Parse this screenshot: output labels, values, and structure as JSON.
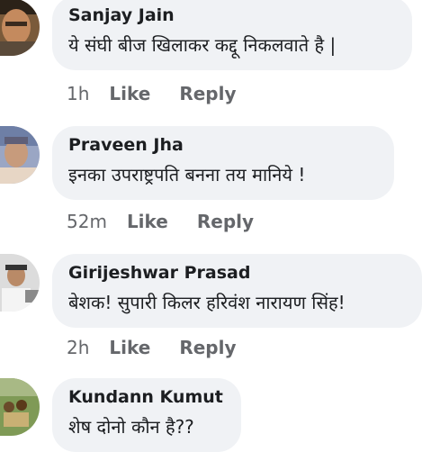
{
  "actions": {
    "like_label": "Like",
    "reply_label": "Reply"
  },
  "comments": [
    {
      "author": "Sanjay Jain",
      "text": "ये संघी बीज खिलाकर कद्दू निकलवाते है |",
      "time": "1h"
    },
    {
      "author": "Praveen Jha",
      "text": "इनका उपराष्ट्रपति बनना तय मानिये !",
      "time": "52m"
    },
    {
      "author": "Girijeshwar Prasad",
      "text": "बेशक! सुपारी किलर हरिवंश नारायण सिंह!",
      "time": "2h"
    },
    {
      "author": "Kundann Kumut",
      "text": "शेष दोनो कौन है??"
    }
  ],
  "colors": {
    "bubble_bg": "#f0f2f5",
    "name_text": "#1c1e21",
    "meta_text": "#65676b"
  }
}
